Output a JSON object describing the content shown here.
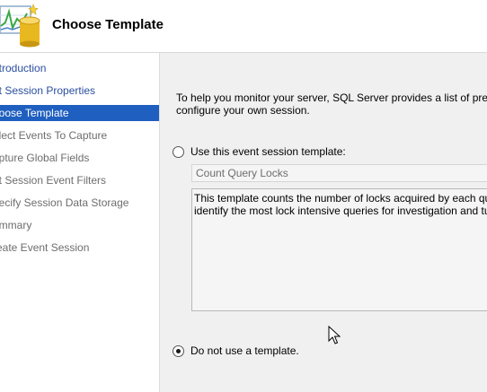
{
  "header": {
    "title": "Choose Template",
    "icon": "chart-database-icon"
  },
  "sidebar": {
    "items": [
      {
        "label": "ntroduction",
        "state": "link"
      },
      {
        "label": "et Session Properties",
        "state": "link"
      },
      {
        "label": "hoose Template",
        "state": "active"
      },
      {
        "label": "elect Events To Capture",
        "state": "disabled"
      },
      {
        "label": "apture Global Fields",
        "state": "disabled"
      },
      {
        "label": "et Session Event Filters",
        "state": "disabled"
      },
      {
        "label": "pecify Session Data Storage",
        "state": "disabled"
      },
      {
        "label": "ummary",
        "state": "disabled"
      },
      {
        "label": "reate Event Session",
        "state": "disabled"
      }
    ]
  },
  "main": {
    "intro_line1": "To help you monitor your server, SQL Server provides a list of pre-configu",
    "intro_line2": "configure your own session.",
    "use_template_label": "Use this event session template:",
    "use_template_selected": false,
    "template_value": "Count Query Locks",
    "description": "This template counts the number of locks acquired by each query bas\nidentify the most lock intensive queries for investigation and tuning.",
    "no_template_label": "Do not use a template.",
    "no_template_selected": true
  },
  "colors": {
    "active_nav_bg": "#1f5fbf",
    "link": "#2a4fa0",
    "disabled_text": "#6d6d6d",
    "panel_bg": "#f0f0f0"
  }
}
